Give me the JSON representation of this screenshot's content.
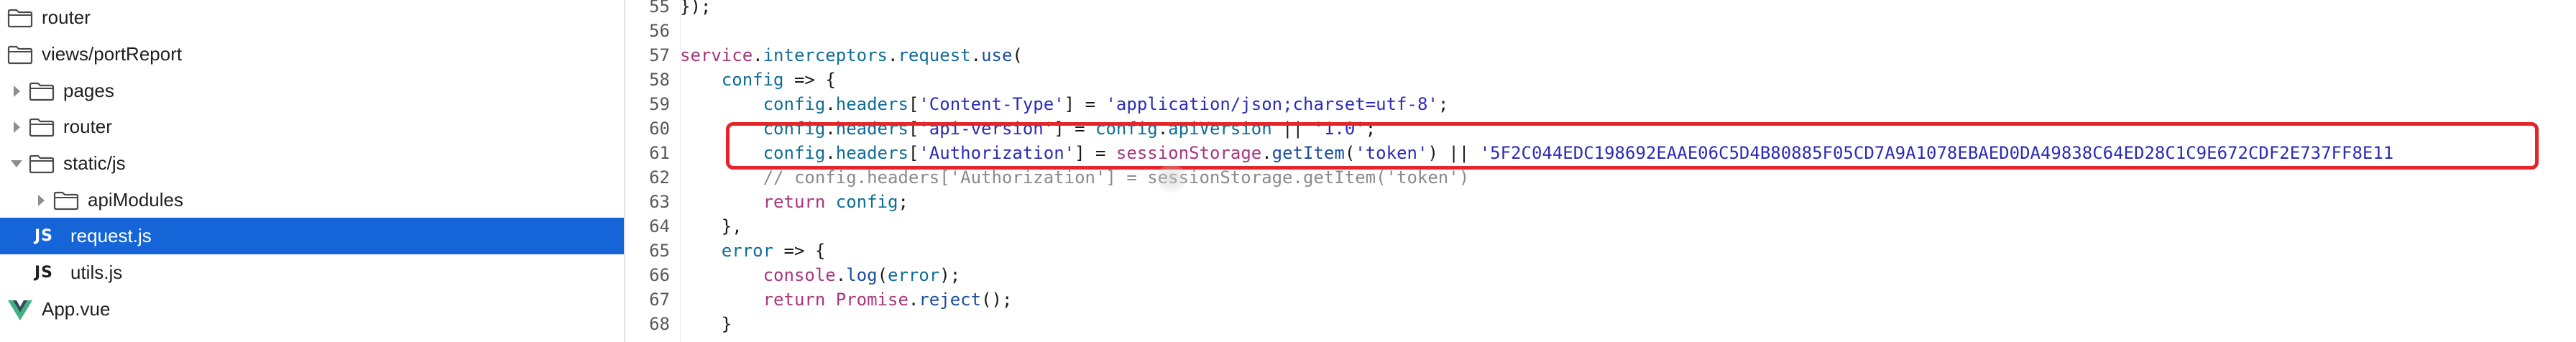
{
  "sidebar": {
    "items": [
      {
        "label": "router",
        "kind": "folder",
        "indent": 0,
        "caret": "none"
      },
      {
        "label": "views/portReport",
        "kind": "folder",
        "indent": 0,
        "caret": "none"
      },
      {
        "label": "pages",
        "kind": "folder",
        "indent": 1,
        "caret": "right"
      },
      {
        "label": "router",
        "kind": "folder",
        "indent": 1,
        "caret": "right"
      },
      {
        "label": "static/js",
        "kind": "folder",
        "indent": 1,
        "caret": "down"
      },
      {
        "label": "apiModules",
        "kind": "folder",
        "indent": 2,
        "caret": "right"
      },
      {
        "label": "request.js",
        "kind": "js",
        "badge": "JS",
        "indent": 2,
        "caret": "none",
        "selected": true
      },
      {
        "label": "utils.js",
        "kind": "js",
        "badge": "JS",
        "indent": 2,
        "caret": "none"
      },
      {
        "label": "App.vue",
        "kind": "vue",
        "indent": 0,
        "caret": "none"
      }
    ],
    "colors": {
      "selected_bg": "#1565d8",
      "selected_fg": "#ffffff",
      "vue_green": "#3fb27f",
      "vue_dark": "#34495e"
    }
  },
  "editor": {
    "line_numbers": [
      "55",
      "56",
      "57",
      "58",
      "59",
      "60",
      "61",
      "62",
      "63",
      "64",
      "65",
      "66",
      "67",
      "68"
    ],
    "lines": [
      {
        "num": "55",
        "text": "});"
      },
      {
        "num": "56",
        "text": ""
      },
      {
        "num": "57",
        "text": "service.interceptors.request.use("
      },
      {
        "num": "58",
        "text": "    config => {"
      },
      {
        "num": "59",
        "text": "        config.headers['Content-Type'] = 'application/json;charset=utf-8';"
      },
      {
        "num": "60",
        "text": "        config.headers['api-version'] = config.apiVersion || '1.0';"
      },
      {
        "num": "61",
        "text": "        config.headers['Authorization'] = sessionStorage.getItem('token') || '5F2C044EDC198692EAAE06C5D4B80885F05CD7A9A1078EBAED0DA49838C64ED28C1C9E672CDF2E737FF8E11"
      },
      {
        "num": "62",
        "text": "        // config.headers['Authorization'] = sessionStorage.getItem('token')"
      },
      {
        "num": "63",
        "text": "        return config;"
      },
      {
        "num": "64",
        "text": "    },"
      },
      {
        "num": "65",
        "text": "    error => {"
      },
      {
        "num": "66",
        "text": "        console.log(error);"
      },
      {
        "num": "67",
        "text": "        return Promise.reject();"
      },
      {
        "num": "68",
        "text": "    }"
      }
    ],
    "colors": {
      "keyword": "#a8357e",
      "property": "#0f6d96",
      "function": "#1a4e9e",
      "string": "#2b2bb8",
      "comment": "#8a8a8a",
      "highlight_border": "#e4262a"
    }
  }
}
